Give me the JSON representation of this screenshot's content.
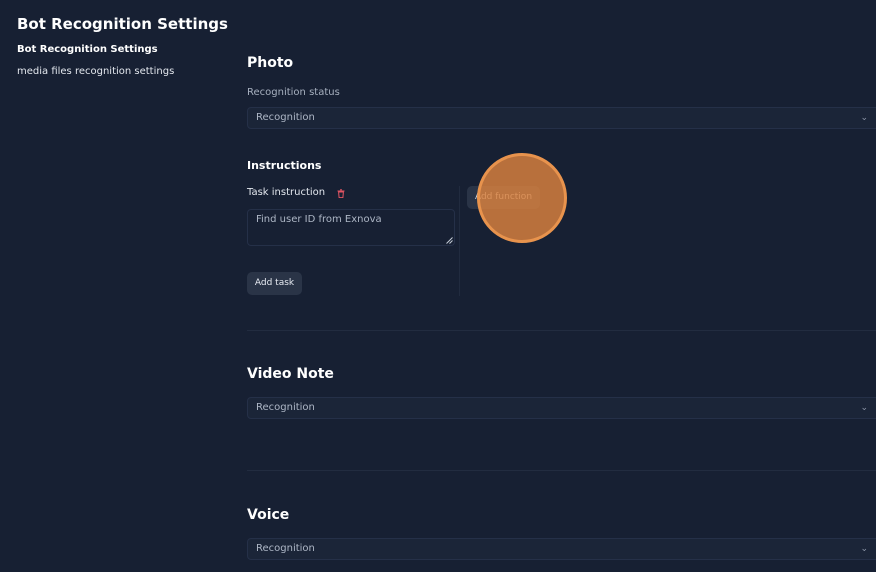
{
  "app": {
    "title": "Bot Recognition Settings"
  },
  "nav": {
    "items": [
      {
        "label": "Bot Recognition Settings"
      },
      {
        "label": "media files recognition settings"
      }
    ]
  },
  "photo": {
    "title": "Photo",
    "status_label": "Recognition status",
    "status_value": "Recognition",
    "instructions_title": "Instructions",
    "task_label": "Task instruction",
    "task_value": "Find user ID from Exnova",
    "add_task_label": "Add task",
    "add_function_label": "Add function"
  },
  "video_note": {
    "title": "Video Note",
    "status_value": "Recognition"
  },
  "voice": {
    "title": "Voice",
    "status_value": "Recognition"
  },
  "colors": {
    "background": "#172033",
    "danger": "#e25563",
    "highlight": "#e8934d"
  },
  "icons": {
    "delete": "trash-icon",
    "dropdown": "chevron-down-icon",
    "resize": "resize-handle-icon"
  }
}
